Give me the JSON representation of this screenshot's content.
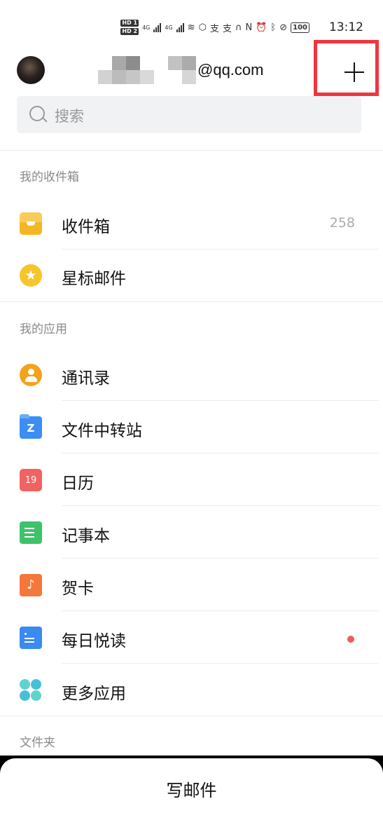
{
  "status_bar": {
    "hd1": "HD 1",
    "hd2": "HD 2",
    "net1": "4G",
    "net2": "4G",
    "pay1": "支",
    "pay2": "支",
    "battery": "100",
    "time": "13:12"
  },
  "header": {
    "email_suffix": "@qq.com",
    "add_icon": "plus-icon",
    "highlight_color": "#f0353f"
  },
  "search": {
    "placeholder": "搜索"
  },
  "sections": {
    "mailbox_title": "我的收件箱",
    "apps_title": "我的应用",
    "folders_title": "文件夹"
  },
  "mailbox": {
    "inbox": {
      "label": "收件箱",
      "count": "258"
    },
    "starred": {
      "label": "星标邮件"
    }
  },
  "apps": {
    "contacts": "通讯录",
    "file_transfer": "文件中转站",
    "file_transfer_glyph": "Z",
    "calendar": "日历",
    "calendar_day": "19",
    "notes": "记事本",
    "card": "贺卡",
    "card_glyph": "♪",
    "daily_read": "每日悦读",
    "more": "更多应用"
  },
  "compose": {
    "label": "写邮件"
  },
  "colors": {
    "unread_dot": "#ef5b5b",
    "accent_red": "#f0353f"
  }
}
